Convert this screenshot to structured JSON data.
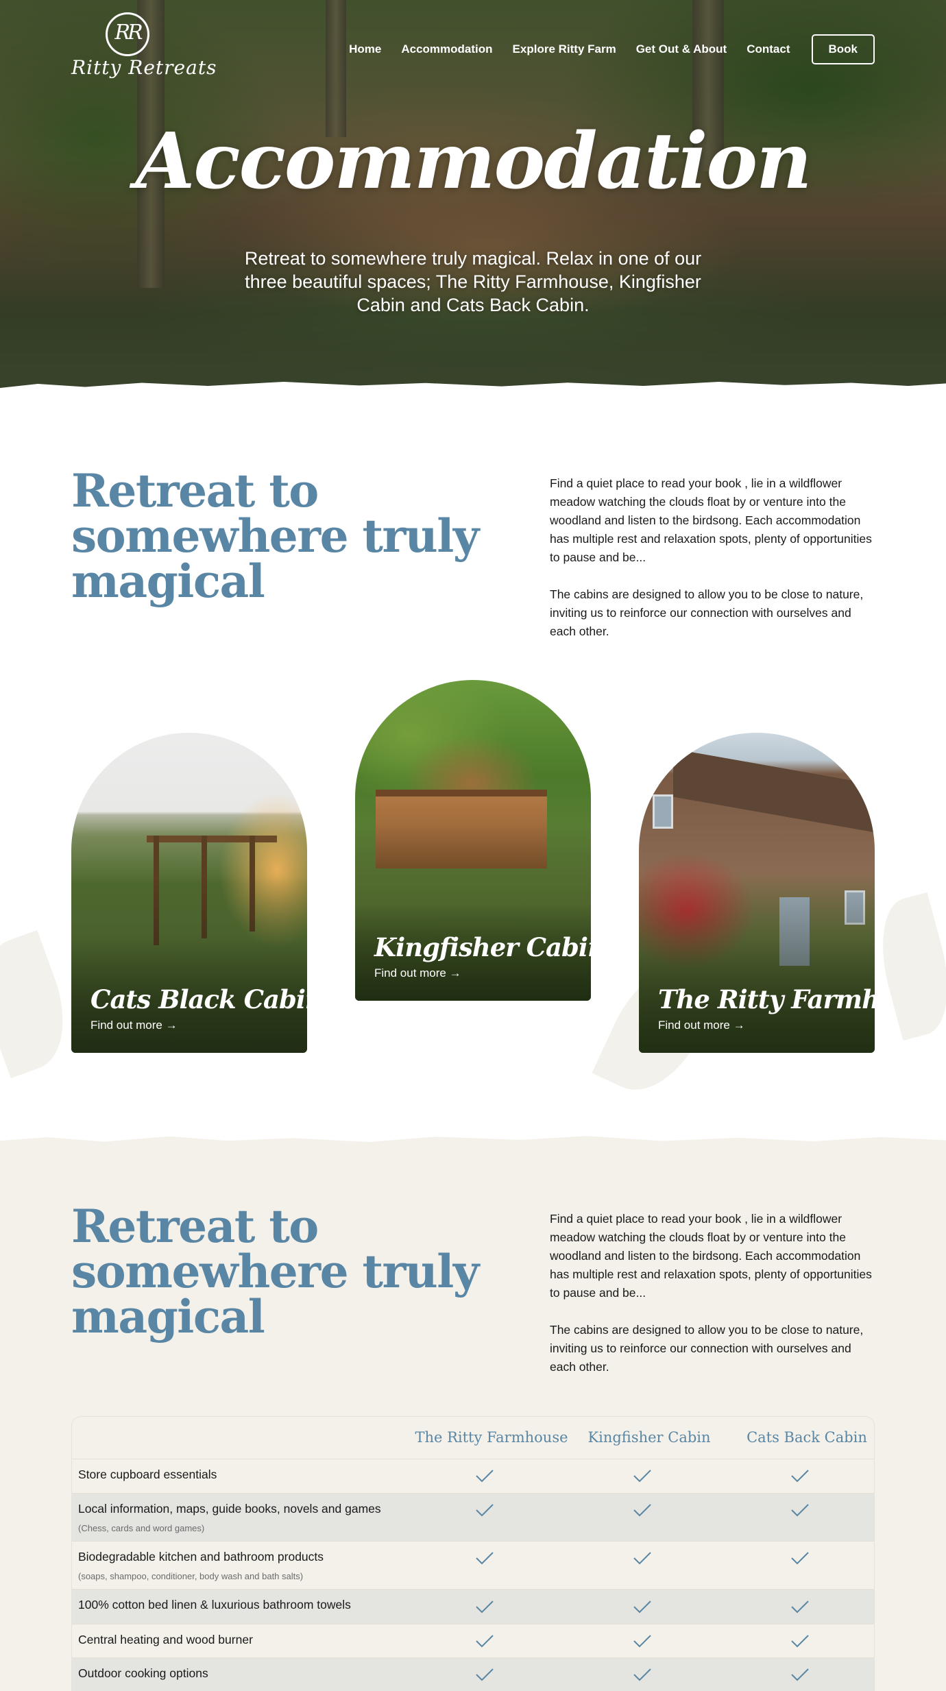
{
  "brand": {
    "monogram": "RR",
    "name": "Ritty Retreats"
  },
  "nav": {
    "items": [
      "Home",
      "Accommodation",
      "Explore Ritty Farm",
      "Get Out & About",
      "Contact"
    ],
    "book_label": "Book"
  },
  "hero": {
    "title": "Accommodation",
    "subtitle": "Retreat to somewhere truly magical.  Relax in one of our three beautiful spaces; The Ritty Farmhouse, Kingfisher Cabin and Cats Back Cabin."
  },
  "intro": {
    "heading": "Retreat to somewhere truly magical",
    "paragraph1": "Find a quiet place to read your book , lie in a wildflower meadow watching the clouds float by or venture into the woodland and listen to the birdsong. Each accommodation has multiple rest and relaxation spots, plenty of opportunities to pause and be...",
    "paragraph2": "The cabins are designed to allow you to be close to nature, inviting us to reinforce our connection with ourselves and each other."
  },
  "cards": [
    {
      "name": "Cats Black Cabin",
      "link": "Find out more →"
    },
    {
      "name": "Kingfisher Cabin",
      "link": "Find out more →"
    },
    {
      "name": "The Ritty Farmhouse",
      "link": "Find out more →"
    }
  ],
  "intro2": {
    "heading": "Retreat to somewhere truly magical",
    "paragraph1": "Find a quiet place to read your book , lie in a wildflower meadow watching the clouds float by or venture into the woodland and listen to the birdsong. Each accommodation has multiple rest and relaxation spots, plenty of opportunities to pause and be...",
    "paragraph2": "The cabins are designed to allow you to be close to nature, inviting us to reinforce our connection with ourselves and each other."
  },
  "comparison": {
    "columns": [
      "The Ritty Farmhouse",
      "Kingfisher Cabin",
      "Cats Back Cabin"
    ],
    "rows": [
      {
        "label": "Store cupboard essentials",
        "note": "",
        "checks": [
          true,
          true,
          true
        ]
      },
      {
        "label": "Local information, maps, guide books, novels and games",
        "note": "(Chess, cards and word games)",
        "checks": [
          true,
          true,
          true
        ]
      },
      {
        "label": "Biodegradable kitchen and bathroom products",
        "note": "(soaps, shampoo, conditioner, body wash and bath salts)",
        "checks": [
          true,
          true,
          true
        ]
      },
      {
        "label": "100% cotton bed linen & luxurious bathroom towels",
        "note": "",
        "checks": [
          true,
          true,
          true
        ]
      },
      {
        "label": "Central heating and wood burner",
        "note": "",
        "checks": [
          true,
          true,
          true
        ]
      },
      {
        "label": "Outdoor cooking options",
        "note": "",
        "checks": [
          true,
          true,
          true
        ]
      }
    ]
  },
  "colors": {
    "accent_blue": "#5986a4",
    "beige": "#f4f1ea",
    "row_alt": "#e4e5e1",
    "text": "#1a1a1a"
  },
  "icons": {
    "check": "check-icon",
    "arrow": "arrow-right-icon"
  }
}
